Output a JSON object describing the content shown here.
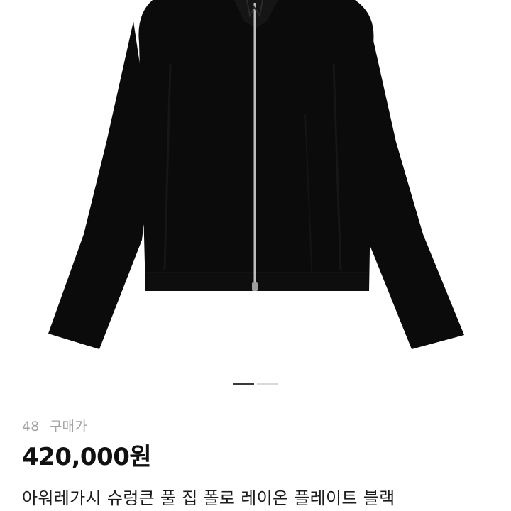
{
  "product": {
    "image_icon": "zip-jacket-image",
    "size": "48",
    "price_label": "구매가",
    "price": "420,000원",
    "title": "아워레가시 슈렁큰 풀 집 폴로 레이온 플레이트 블랙"
  },
  "carousel": {
    "total": 2,
    "active_index": 0
  },
  "colors": {
    "garment": "#0b0b0b",
    "zipper": "#bdbdbd",
    "dot_active": "#3a3a3a",
    "dot_inactive": "#d9d9d9",
    "muted_text": "#a3a3a3"
  }
}
